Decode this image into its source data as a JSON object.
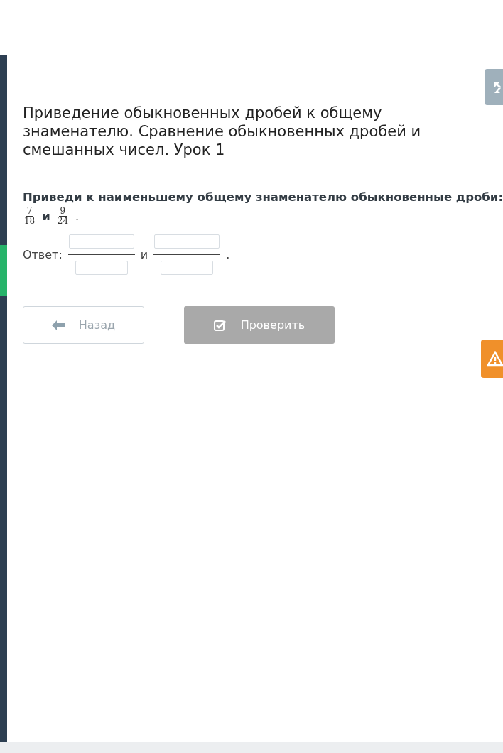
{
  "lesson_title": "Приведение обыкновенных дробей к общему знаменателю. Сравнение обыкновенных дробей и смешанных чисел. Урок 1",
  "task": {
    "prompt": "Приведи к наименьшему общему знаменателю обыкновенные дроби:",
    "fractions": [
      {
        "numerator": "7",
        "denominator": "18"
      },
      {
        "numerator": "9",
        "denominator": "24"
      }
    ],
    "joiner": "и",
    "end": "."
  },
  "answer": {
    "label": "Ответ:",
    "joiner": "и",
    "end": ".",
    "fractions": [
      {
        "kind": "blank"
      },
      {
        "kind": "blank"
      }
    ]
  },
  "buttons": [
    {
      "kind": "back",
      "label": "Назад",
      "disabled": false
    },
    {
      "kind": "check",
      "label": "Проверить",
      "disabled": true
    }
  ],
  "sidebar": {
    "items": [
      {
        "selected": false
      },
      {
        "selected": true
      },
      {
        "selected": false
      }
    ]
  }
}
